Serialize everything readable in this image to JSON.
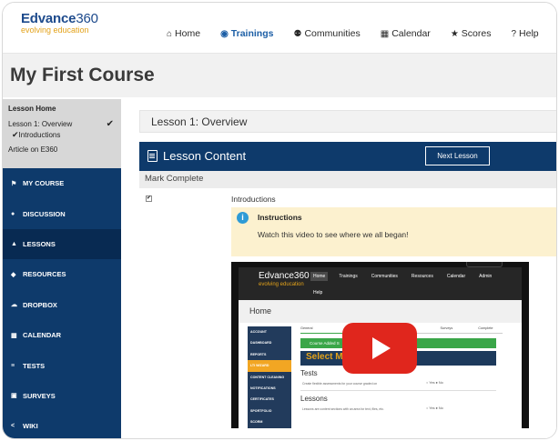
{
  "brand": {
    "name_a": "Edvance",
    "name_b": "360",
    "tagline": "evolving education",
    "color_primary": "#0e3a6b",
    "color_accent": "#e3a21a"
  },
  "nav": [
    {
      "label": "Home",
      "icon": "home-icon",
      "glyph": "⌂"
    },
    {
      "label": "Trainings",
      "icon": "play-circle-icon",
      "glyph": "◉"
    },
    {
      "label": "Communities",
      "icon": "users-icon",
      "glyph": "⚉"
    },
    {
      "label": "Calendar",
      "icon": "calendar-icon",
      "glyph": "▦"
    },
    {
      "label": "Scores",
      "icon": "trophy-icon",
      "glyph": "★"
    },
    {
      "label": "Help",
      "icon": "help-icon",
      "glyph": "?"
    }
  ],
  "nav_active": "Trainings",
  "page_title": "My First Course",
  "lesson_menu": {
    "heading": "Lesson Home",
    "lesson": "Lesson 1: Overview",
    "subitem": "Introductions",
    "article": "Article on  E360"
  },
  "sidebar": [
    {
      "label": "MY COURSE",
      "icon": "flag-icon",
      "glyph": "⚑"
    },
    {
      "label": "DISCUSSION",
      "icon": "chat-icon",
      "glyph": "●"
    },
    {
      "label": "LESSONS",
      "icon": "lessons-icon",
      "glyph": "▲"
    },
    {
      "label": "RESOURCES",
      "icon": "tag-icon",
      "glyph": "◆"
    },
    {
      "label": "DROPBOX",
      "icon": "cloud-icon",
      "glyph": "☁"
    },
    {
      "label": "CALENDAR",
      "icon": "calendar-icon",
      "glyph": "▦"
    },
    {
      "label": "TESTS",
      "icon": "list-icon",
      "glyph": "≡"
    },
    {
      "label": "SURVEYS",
      "icon": "clipboard-icon",
      "glyph": "▣"
    },
    {
      "label": "WIKI",
      "icon": "share-icon",
      "glyph": "<"
    }
  ],
  "sidebar_active": "LESSONS",
  "main": {
    "overview_title": "Lesson 1: Overview",
    "content_title": "Lesson Content",
    "next_button": "Next Lesson",
    "mark_complete": "Mark Complete",
    "item_label": "Introductions",
    "info_title": "Instructions",
    "info_text": "Watch this video to see where we all began!",
    "info_badge": "i"
  },
  "video": {
    "logo": "Edvance360",
    "logo_tag": "evolving education",
    "nav": [
      "Home",
      "Trainings",
      "Communities",
      "Resources",
      "Calendar",
      "Admin",
      "Help"
    ],
    "home": "Home",
    "side": [
      "ACCOUNT",
      "DASHBOARD",
      "REPORTS",
      "LTI WIZARD",
      "CONTENT CLEANING",
      "NOTIFICATIONS",
      "CERTIFICATES",
      "SPORTFOLIO",
      "SCORM"
    ],
    "tabs": [
      "General",
      "",
      "",
      "",
      "",
      "Surveys",
      "Complete"
    ],
    "green": "Course Added S",
    "select": "Select Mo",
    "tests": "Tests",
    "tests_text": "Create flexible assessments for your course graded on",
    "lessons": "Lessons",
    "lessons_text": "Lessons are content sections with an area for text, files, etc.",
    "yes": "Yes",
    "no": "No"
  }
}
